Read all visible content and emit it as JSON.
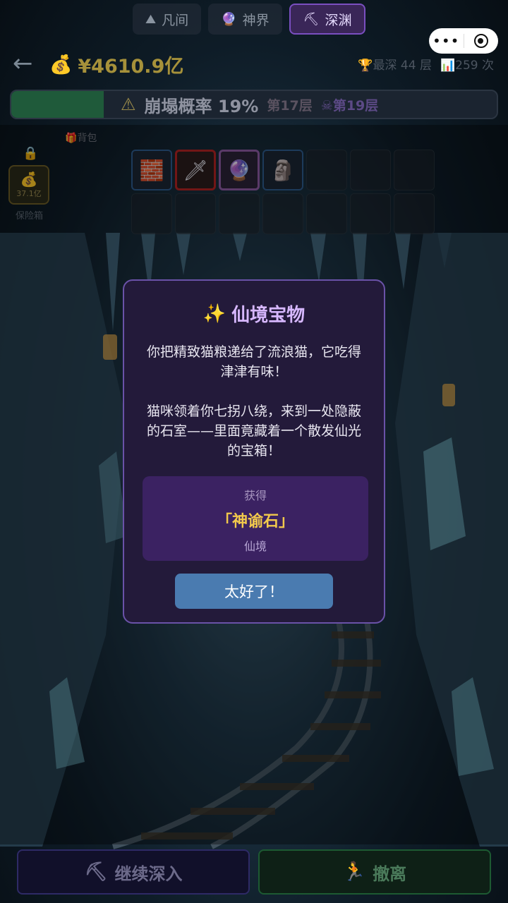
{
  "tabs": [
    {
      "icon": "⛰",
      "label": "凡间",
      "active": false
    },
    {
      "icon": "🔮",
      "label": "神界",
      "active": false
    },
    {
      "icon": "⛏",
      "label": "深渊",
      "active": true
    }
  ],
  "header": {
    "money_icon": "💰",
    "money": "¥4610.9亿",
    "deepest": "最深 44 层",
    "count": "259 次"
  },
  "progress": {
    "fill_fraction": 0.19,
    "collapse": "崩塌概率 19%",
    "current_layer": "第17层",
    "deep_layer": "第19层"
  },
  "safe": {
    "value": "37.1亿",
    "label": "保险箱"
  },
  "bag_label": "背包",
  "modal": {
    "title": "仙境宝物",
    "paragraph1": "你把精致猫粮递给了流浪猫，它吃得津津有味！",
    "paragraph2": "猫咪领着你七拐八绕，来到一处隐蔽的石室——里面竟藏着一个散发仙光的宝箱！",
    "reward_label": "获得",
    "reward_name": "「神谕石」",
    "reward_tier": "仙境",
    "ok_label": "太好了！"
  },
  "bottom": {
    "continue_label": "继续深入",
    "retreat_label": "撤离"
  },
  "colors": {
    "accent_purple": "#6a52a8",
    "reward_gold": "#f2c94c",
    "button_blue": "#4a7bb0"
  }
}
